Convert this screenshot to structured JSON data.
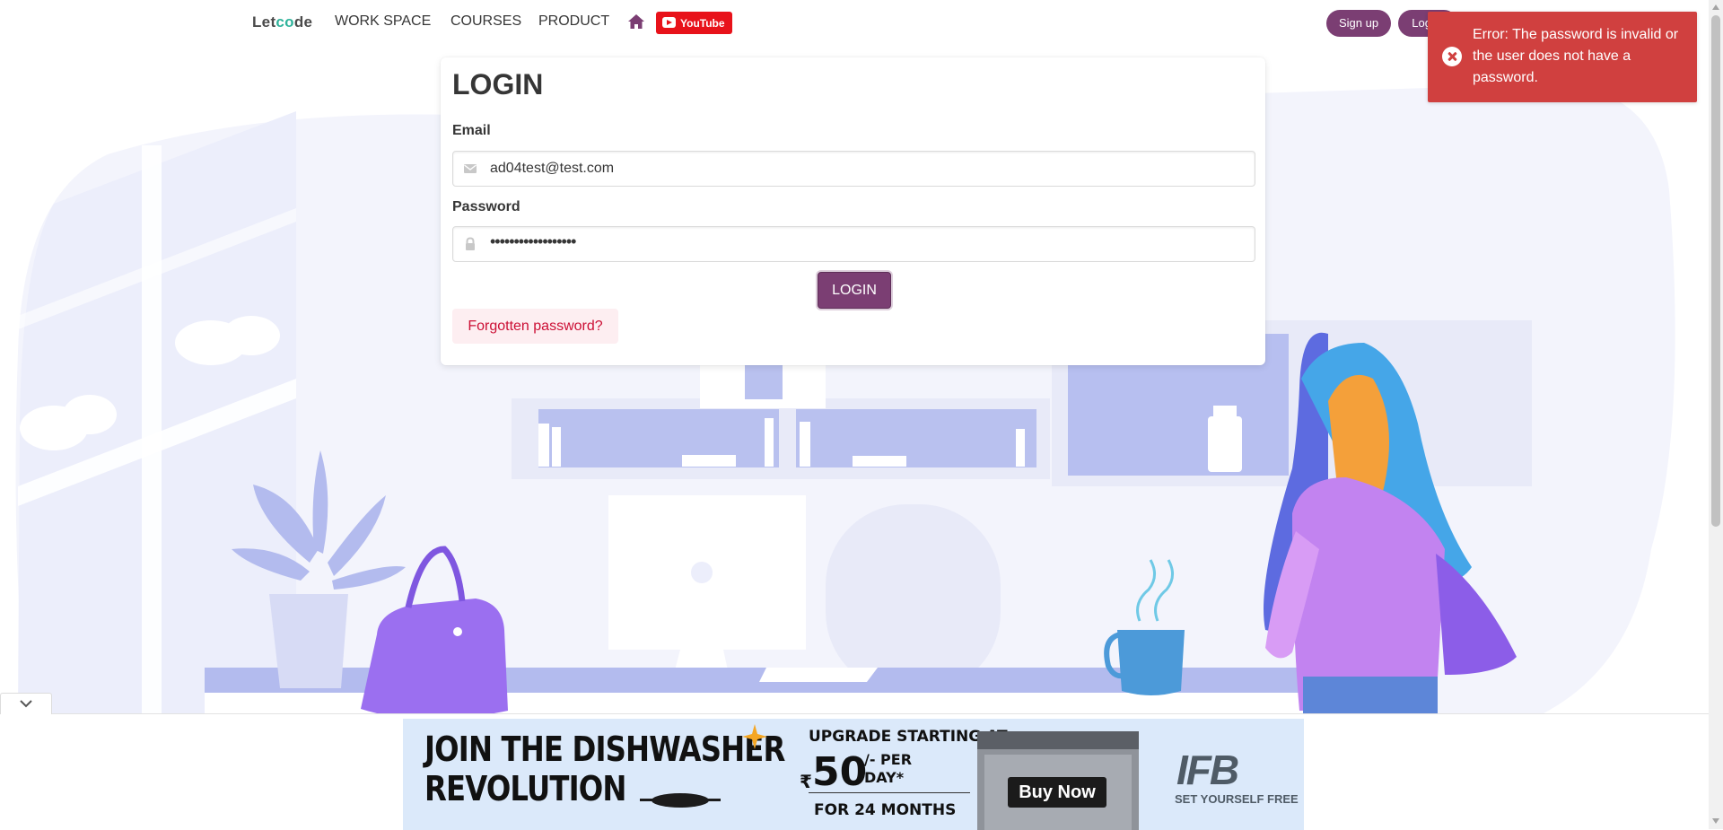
{
  "navbar": {
    "brand_prefix": "Let",
    "brand_accent": "co",
    "brand_suffix": "de",
    "items": [
      "WORK SPACE",
      "COURSES",
      "PRODUCT"
    ],
    "youtube_label": "YouTube",
    "signup_label": "Sign up",
    "login_label": "Log in"
  },
  "login": {
    "title": "LOGIN",
    "email_label": "Email",
    "email_value": "ad04test@test.com",
    "password_label": "Password",
    "password_mask": "••••••••••••••••••",
    "submit_label": "LOGIN",
    "forgot_label": "Forgotten password?"
  },
  "toast": {
    "message": "Error: The password is invalid or the user does not have a password."
  },
  "ad": {
    "headline_1": "JOIN THE DISHWASHER",
    "headline_2": "REVOLUTION",
    "upgrade_text": "UPGRADE STARTING AT",
    "currency": "₹",
    "price": "50",
    "per_1": "/- PER",
    "per_2": "DAY*",
    "months": "FOR 24 MONTHS",
    "buy_label": "Buy Now",
    "brand": "IFB",
    "tagline": "SET YOURSELF FREE"
  },
  "colors": {
    "primary": "#7b3e73",
    "error": "#d0403f",
    "danger_light": "#fdeef1",
    "illustration_light": "#f1f2fb",
    "illustration_mid": "#b8c0f0"
  },
  "icons": [
    "home-icon",
    "youtube-icon",
    "envelope-icon",
    "lock-icon",
    "error-circle-icon",
    "chevron-down-icon",
    "adchoices-icon",
    "close-icon"
  ]
}
